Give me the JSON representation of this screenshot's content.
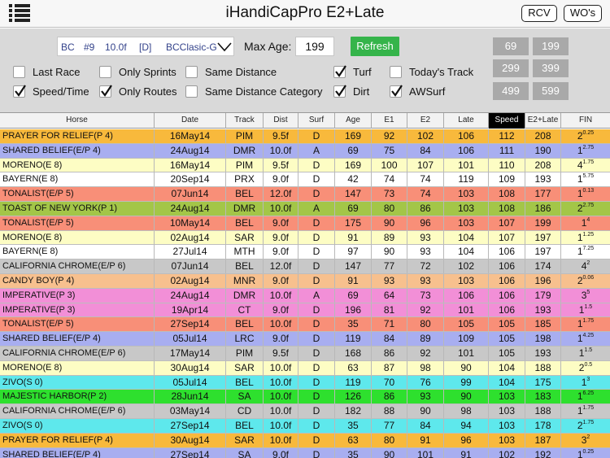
{
  "header": {
    "title": "iHandiCapPro E2+Late",
    "rcv_label": "RCV",
    "wos_label": "WO's"
  },
  "filters": {
    "race_selector": [
      "BC",
      "#9",
      "10.0f",
      "[D]",
      "BCClasic-G"
    ],
    "max_age_label": "Max Age:",
    "max_age_value": "199",
    "refresh_label": "Refresh",
    "checkboxes": [
      {
        "label": "Last Race",
        "checked": false
      },
      {
        "label": "Only Sprints",
        "checked": false
      },
      {
        "label": "Same Distance",
        "checked": false
      },
      {
        "label": "Turf",
        "checked": true
      },
      {
        "label": "Today's Track",
        "checked": false
      },
      {
        "label": "Speed/Time",
        "checked": true
      },
      {
        "label": "Only Routes",
        "checked": true
      },
      {
        "label": "Same Distance Category",
        "checked": false
      },
      {
        "label": "Dirt",
        "checked": true
      },
      {
        "label": "AWSurf",
        "checked": true
      }
    ],
    "range_buttons": [
      "69",
      "199",
      "299",
      "399",
      "499",
      "599"
    ]
  },
  "table": {
    "columns": [
      "Horse",
      "Date",
      "Track",
      "Dist",
      "Surf",
      "Age",
      "E1",
      "E2",
      "Late",
      "Speed",
      "E2+Late",
      "FIN"
    ],
    "rows": [
      {
        "horse": "PRAYER FOR RELIEF(P   4)",
        "date": "16May14",
        "track": "PIM",
        "dist": "9.5f",
        "surf": "D",
        "age": "169",
        "e1": "92",
        "e2": "102",
        "late": "106",
        "speed": "112",
        "e2late": "208",
        "fin": "2",
        "fin_sup": "0.25",
        "color": "#f8b93c"
      },
      {
        "horse": "SHARED BELIEF(E/P 4)",
        "date": "24Aug14",
        "track": "DMR",
        "dist": "10.0f",
        "surf": "A",
        "age": "69",
        "e1": "75",
        "e2": "84",
        "late": "106",
        "speed": "111",
        "e2late": "190",
        "fin": "1",
        "fin_sup": "2.75",
        "color": "#a8aef0"
      },
      {
        "horse": "MORENO(E   8)",
        "date": "16May14",
        "track": "PIM",
        "dist": "9.5f",
        "surf": "D",
        "age": "169",
        "e1": "100",
        "e2": "107",
        "late": "101",
        "speed": "110",
        "e2late": "208",
        "fin": "4",
        "fin_sup": "1.75",
        "color": "#fdfdc4"
      },
      {
        "horse": "BAYERN(E   8)",
        "date": "20Sep14",
        "track": "PRX",
        "dist": "9.0f",
        "surf": "D",
        "age": "42",
        "e1": "74",
        "e2": "74",
        "late": "119",
        "speed": "109",
        "e2late": "193",
        "fin": "1",
        "fin_sup": "5.75",
        "color": "#ffffff"
      },
      {
        "horse": "TONALIST(E/P 5)",
        "date": "07Jun14",
        "track": "BEL",
        "dist": "12.0f",
        "surf": "D",
        "age": "147",
        "e1": "73",
        "e2": "74",
        "late": "103",
        "speed": "108",
        "e2late": "177",
        "fin": "1",
        "fin_sup": "0.13",
        "color": "#f88f78"
      },
      {
        "horse": "TOAST OF NEW YORK(P   1)",
        "date": "24Aug14",
        "track": "DMR",
        "dist": "10.0f",
        "surf": "A",
        "age": "69",
        "e1": "80",
        "e2": "86",
        "late": "103",
        "speed": "108",
        "e2late": "186",
        "fin": "2",
        "fin_sup": "2.75",
        "color": "#a3c648"
      },
      {
        "horse": "TONALIST(E/P 5)",
        "date": "10May14",
        "track": "BEL",
        "dist": "9.0f",
        "surf": "D",
        "age": "175",
        "e1": "90",
        "e2": "96",
        "late": "103",
        "speed": "107",
        "e2late": "199",
        "fin": "1",
        "fin_sup": "4",
        "color": "#f88f78"
      },
      {
        "horse": "MORENO(E   8)",
        "date": "02Aug14",
        "track": "SAR",
        "dist": "9.0f",
        "surf": "D",
        "age": "91",
        "e1": "89",
        "e2": "93",
        "late": "104",
        "speed": "107",
        "e2late": "197",
        "fin": "1",
        "fin_sup": "1.25",
        "color": "#fdfdc4"
      },
      {
        "horse": "BAYERN(E   8)",
        "date": "27Jul14",
        "track": "MTH",
        "dist": "9.0f",
        "surf": "D",
        "age": "97",
        "e1": "90",
        "e2": "93",
        "late": "104",
        "speed": "106",
        "e2late": "197",
        "fin": "1",
        "fin_sup": "7.25",
        "color": "#ffffff"
      },
      {
        "horse": "CALIFORNIA CHROME(E/P 6)",
        "date": "07Jun14",
        "track": "BEL",
        "dist": "12.0f",
        "surf": "D",
        "age": "147",
        "e1": "77",
        "e2": "72",
        "late": "102",
        "speed": "106",
        "e2late": "174",
        "fin": "4",
        "fin_sup": "2",
        "color": "#c8c8c8"
      },
      {
        "horse": "CANDY BOY(P   4)",
        "date": "02Aug14",
        "track": "MNR",
        "dist": "9.0f",
        "surf": "D",
        "age": "91",
        "e1": "93",
        "e2": "93",
        "late": "103",
        "speed": "106",
        "e2late": "196",
        "fin": "2",
        "fin_sup": "0.06",
        "color": "#f7c08e"
      },
      {
        "horse": "IMPERATIVE(P   3)",
        "date": "24Aug14",
        "track": "DMR",
        "dist": "10.0f",
        "surf": "A",
        "age": "69",
        "e1": "64",
        "e2": "73",
        "late": "106",
        "speed": "106",
        "e2late": "179",
        "fin": "3",
        "fin_sup": "5",
        "color": "#f28fd7"
      },
      {
        "horse": "IMPERATIVE(P   3)",
        "date": "19Apr14",
        "track": "CT",
        "dist": "9.0f",
        "surf": "D",
        "age": "196",
        "e1": "81",
        "e2": "92",
        "late": "101",
        "speed": "106",
        "e2late": "193",
        "fin": "1",
        "fin_sup": "1.5",
        "color": "#f28fd7"
      },
      {
        "horse": "TONALIST(E/P 5)",
        "date": "27Sep14",
        "track": "BEL",
        "dist": "10.0f",
        "surf": "D",
        "age": "35",
        "e1": "71",
        "e2": "80",
        "late": "105",
        "speed": "105",
        "e2late": "185",
        "fin": "1",
        "fin_sup": "1.75",
        "color": "#f88f78"
      },
      {
        "horse": "SHARED BELIEF(E/P 4)",
        "date": "05Jul14",
        "track": "LRC",
        "dist": "9.0f",
        "surf": "D",
        "age": "119",
        "e1": "84",
        "e2": "89",
        "late": "109",
        "speed": "105",
        "e2late": "198",
        "fin": "1",
        "fin_sup": "4.25",
        "color": "#a8aef0"
      },
      {
        "horse": "CALIFORNIA CHROME(E/P 6)",
        "date": "17May14",
        "track": "PIM",
        "dist": "9.5f",
        "surf": "D",
        "age": "168",
        "e1": "86",
        "e2": "92",
        "late": "101",
        "speed": "105",
        "e2late": "193",
        "fin": "1",
        "fin_sup": "1.5",
        "color": "#c8c8c8"
      },
      {
        "horse": "MORENO(E   8)",
        "date": "30Aug14",
        "track": "SAR",
        "dist": "10.0f",
        "surf": "D",
        "age": "63",
        "e1": "87",
        "e2": "98",
        "late": "90",
        "speed": "104",
        "e2late": "188",
        "fin": "2",
        "fin_sup": "0.5",
        "color": "#fdfdc4"
      },
      {
        "horse": "ZIVO(S   0)",
        "date": "05Jul14",
        "track": "BEL",
        "dist": "10.0f",
        "surf": "D",
        "age": "119",
        "e1": "70",
        "e2": "76",
        "late": "99",
        "speed": "104",
        "e2late": "175",
        "fin": "1",
        "fin_sup": "3",
        "color": "#5ee8ec"
      },
      {
        "horse": "MAJESTIC HARBOR(P   2)",
        "date": "28Jun14",
        "track": "SA",
        "dist": "10.0f",
        "surf": "D",
        "age": "126",
        "e1": "86",
        "e2": "93",
        "late": "90",
        "speed": "103",
        "e2late": "183",
        "fin": "1",
        "fin_sup": "6.25",
        "color": "#2ee02e"
      },
      {
        "horse": "CALIFORNIA CHROME(E/P 6)",
        "date": "03May14",
        "track": "CD",
        "dist": "10.0f",
        "surf": "D",
        "age": "182",
        "e1": "88",
        "e2": "90",
        "late": "98",
        "speed": "103",
        "e2late": "188",
        "fin": "1",
        "fin_sup": "1.75",
        "color": "#c8c8c8"
      },
      {
        "horse": "ZIVO(S   0)",
        "date": "27Sep14",
        "track": "BEL",
        "dist": "10.0f",
        "surf": "D",
        "age": "35",
        "e1": "77",
        "e2": "84",
        "late": "94",
        "speed": "103",
        "e2late": "178",
        "fin": "2",
        "fin_sup": "1.75",
        "color": "#5ee8ec"
      },
      {
        "horse": "PRAYER FOR RELIEF(P   4)",
        "date": "30Aug14",
        "track": "SAR",
        "dist": "10.0f",
        "surf": "D",
        "age": "63",
        "e1": "80",
        "e2": "91",
        "late": "96",
        "speed": "103",
        "e2late": "187",
        "fin": "3",
        "fin_sup": "2",
        "color": "#f8b93c"
      },
      {
        "horse": "SHARED BELIEF(E/P 4)",
        "date": "27Sep14",
        "track": "SA",
        "dist": "9.0f",
        "surf": "D",
        "age": "35",
        "e1": "90",
        "e2": "101",
        "late": "91",
        "speed": "102",
        "e2late": "192",
        "fin": "1",
        "fin_sup": "0.25",
        "color": "#a8aef0"
      }
    ]
  }
}
